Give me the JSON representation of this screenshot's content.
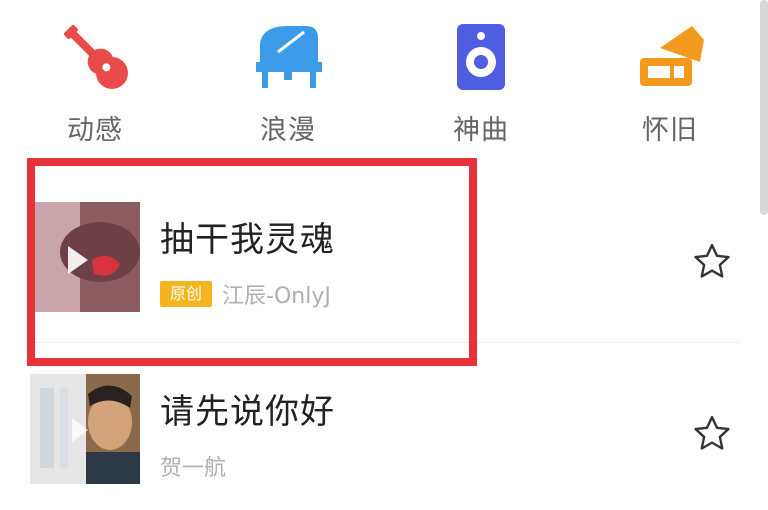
{
  "categories": [
    {
      "label": "动感",
      "icon": "guitar-icon",
      "color": "#e94a4a"
    },
    {
      "label": "浪漫",
      "icon": "piano-icon",
      "color": "#3b9be8"
    },
    {
      "label": "神曲",
      "icon": "speaker-icon",
      "color": "#4f5de0"
    },
    {
      "label": "怀旧",
      "icon": "gramophone-icon",
      "color": "#f39a1e"
    }
  ],
  "songs": [
    {
      "title": "抽干我灵魂",
      "tag": "原创",
      "artist": "江辰-OnlyJ",
      "highlighted": true
    },
    {
      "title": "请先说你好",
      "tag": "",
      "artist": "贺一航",
      "highlighted": false
    }
  ],
  "colors": {
    "highlight": "#e8323a",
    "tag": "#f6b51e"
  }
}
